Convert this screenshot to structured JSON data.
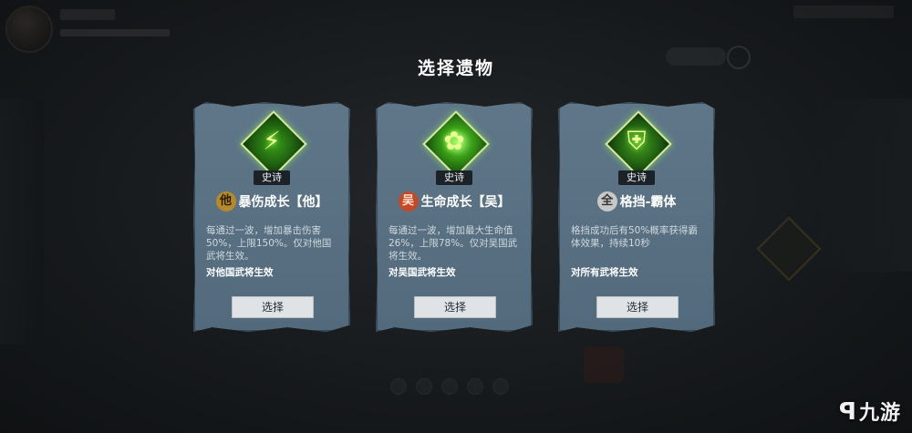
{
  "panel": {
    "title": "选择遗物"
  },
  "colors": {
    "card": "#5b7284",
    "accent_green": "#3aa018",
    "button": "#dfe3e6"
  },
  "relics": [
    {
      "icon": "green-slash-icon",
      "icon_glyph": "⚡",
      "rarity": "史诗",
      "badge_char": "他",
      "name": "暴伤成长【他】",
      "desc": "每通过一波，增加暴击伤害50%，上限150%。仅对他国武将生效。",
      "faction": "对他国武将生效",
      "button": "选择"
    },
    {
      "icon": "green-leaf-icon",
      "icon_glyph": "✿",
      "rarity": "史诗",
      "badge_char": "吴",
      "name": "生命成长【吴】",
      "desc": "每通过一波，增加最大生命值26%，上限78%。仅对吴国武将生效。",
      "faction": "对吴国武将生效",
      "button": "选择"
    },
    {
      "icon": "green-shield-icon",
      "icon_glyph": "⛨",
      "rarity": "史诗",
      "badge_char": "全",
      "name": "格挡-霸体",
      "desc": "格挡成功后有50%概率获得霸体效果，持续10秒",
      "faction": "对所有武将生效",
      "button": "选择"
    }
  ],
  "watermark": {
    "mark": "ꟼ",
    "text": "九游"
  }
}
